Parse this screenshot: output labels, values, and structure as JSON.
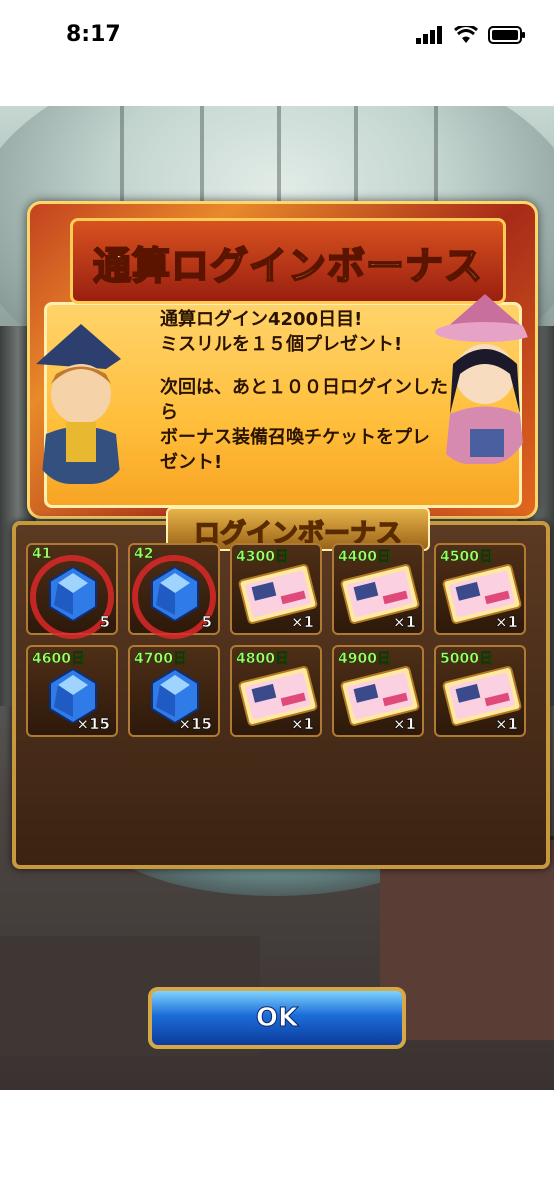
{
  "status_bar": {
    "time": "8:17"
  },
  "banner": {
    "title": "通算ログインボーナス",
    "line1": "通算ログイン4200日目!",
    "line2": "ミスリルを１５個プレゼント!",
    "line3": "次回は、あと１００日ログインした",
    "line4": "ら",
    "line5": "ボーナス装備召喚チケットをプレ",
    "line6": "ゼント!"
  },
  "grid": {
    "title": "ログインボーナス",
    "cells": [
      {
        "day": "41",
        "item": "gem",
        "qty": "5",
        "claimed": true
      },
      {
        "day": "42",
        "item": "gem",
        "qty": "5",
        "claimed": true
      },
      {
        "day": "4300日",
        "item": "ticket",
        "qty": "×1",
        "claimed": false
      },
      {
        "day": "4400日",
        "item": "ticket",
        "qty": "×1",
        "claimed": false
      },
      {
        "day": "4500日",
        "item": "ticket",
        "qty": "×1",
        "claimed": false
      },
      {
        "day": "4600日",
        "item": "gem",
        "qty": "×15",
        "claimed": false
      },
      {
        "day": "4700日",
        "item": "gem",
        "qty": "×15",
        "claimed": false
      },
      {
        "day": "4800日",
        "item": "ticket",
        "qty": "×1",
        "claimed": false
      },
      {
        "day": "4900日",
        "item": "ticket",
        "qty": "×1",
        "claimed": false
      },
      {
        "day": "5000日",
        "item": "ticket",
        "qty": "×1",
        "claimed": false
      }
    ]
  },
  "ok_button": {
    "label": "OK"
  }
}
